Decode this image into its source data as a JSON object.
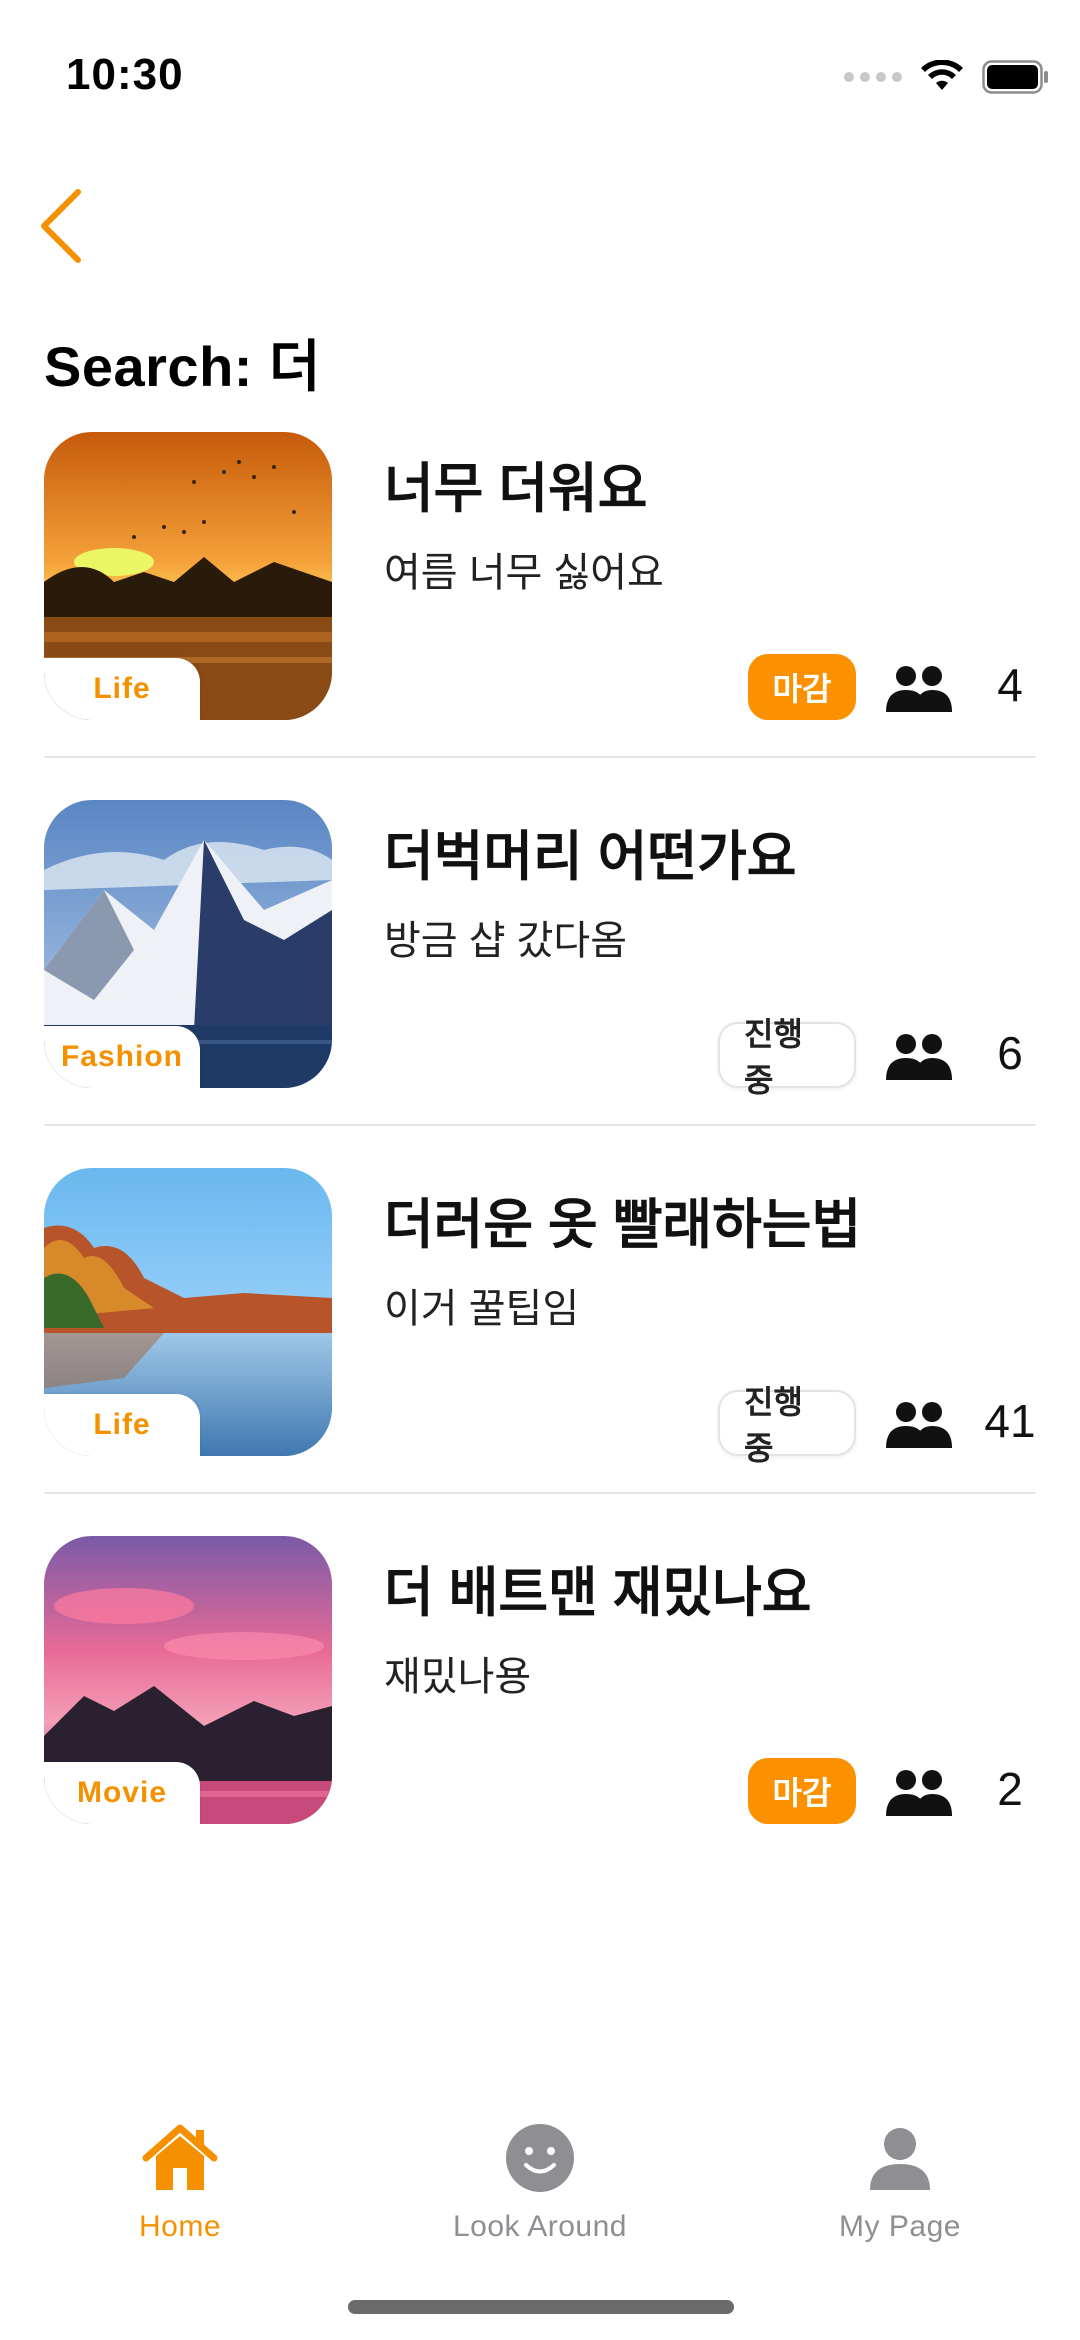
{
  "status_bar": {
    "time": "10:30"
  },
  "header": {
    "search_title": "Search: 더"
  },
  "items": [
    {
      "category": "Life",
      "title": "너무 더워요",
      "subtitle": "여름 너무 싫어요",
      "status": "마감",
      "participants": "4"
    },
    {
      "category": "Fashion",
      "title": "더벅머리 어떤가요",
      "subtitle": "방금 샵 갔다옴",
      "status": "진행중",
      "participants": "6"
    },
    {
      "category": "Life",
      "title": "더러운 옷 빨래하는법",
      "subtitle": "이거 꿀팁임",
      "status": "진행중",
      "participants": "41"
    },
    {
      "category": "Movie",
      "title": "더 배트맨 재밌나요",
      "subtitle": "재밌나용",
      "status": "마감",
      "participants": "2"
    }
  ],
  "tab_bar": {
    "tabs": [
      {
        "label": "Home",
        "icon": "house-icon",
        "active": true
      },
      {
        "label": "Look Around",
        "icon": "smiley-face-icon",
        "active": false
      },
      {
        "label": "My Page",
        "icon": "person-icon",
        "active": false
      }
    ]
  },
  "colors": {
    "accent": "#F59100",
    "closed_badge": "#FB9100",
    "inactive_tab": "#8E8E93"
  }
}
